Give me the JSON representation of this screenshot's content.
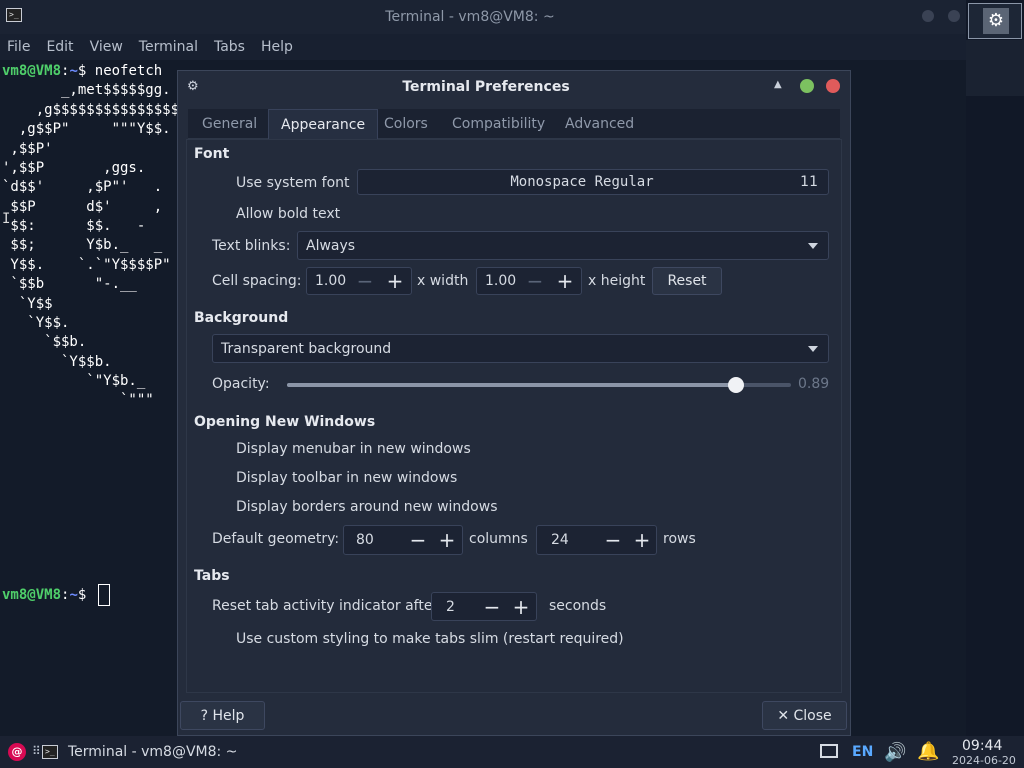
{
  "terminal": {
    "title": "Terminal - vm8@VM8: ~",
    "menu": [
      "File",
      "Edit",
      "View",
      "Terminal",
      "Tabs",
      "Help"
    ],
    "prompt_user": "vm8@VM8",
    "prompt_sep": ":",
    "prompt_path": "~",
    "prompt_suffix": "$",
    "command": "neofetch",
    "ascii_lines": [
      "       _,met$$$$$gg.",
      "    ,g$$$$$$$$$$$$$$$",
      "  ,g$$P\"     \"\"\"Y$$.",
      " ,$$P'",
      "',$$P       ,ggs.",
      "`d$$'     ,$P\"'   .",
      " $$P      d$'     ,",
      " $$:      $$.   -",
      " $$;      Y$b._   _",
      " Y$$.    `.`\"Y$$$$P\"",
      " `$$b      \"-.__",
      "  `Y$$",
      "   `Y$$.",
      "     `$$b.",
      "       `Y$$b.",
      "          `\"Y$b._",
      "              `\"\"\""
    ]
  },
  "workspace_icon": "gear-icon",
  "dialog": {
    "title": "Terminal Preferences",
    "tabs": [
      "General",
      "Appearance",
      "Colors",
      "Compatibility",
      "Advanced"
    ],
    "active_tab": "Appearance",
    "font": {
      "section": "Font",
      "use_system_font": "Use system font",
      "font_name": "Monospace Regular",
      "font_size": "11",
      "allow_bold": "Allow bold text",
      "text_blinks_label": "Text blinks:",
      "text_blinks_value": "Always",
      "cell_spacing_label": "Cell spacing:",
      "width_value": "1.00",
      "width_unit": "x width",
      "height_value": "1.00",
      "height_unit": "x height",
      "reset": "Reset"
    },
    "background": {
      "section": "Background",
      "mode": "Transparent background",
      "opacity_label": "Opacity:",
      "opacity_value": "0.89",
      "opacity_fraction": 0.89
    },
    "new_windows": {
      "section": "Opening New Windows",
      "menubar": "Display menubar in new windows",
      "toolbar": "Display toolbar in new windows",
      "borders": "Display borders around new windows",
      "geometry_label": "Default geometry:",
      "columns_value": "80",
      "columns_unit": "columns",
      "rows_value": "24",
      "rows_unit": "rows"
    },
    "tabs_section": {
      "section": "Tabs",
      "reset_label": "Reset tab activity indicator after",
      "reset_value": "2",
      "reset_unit": "seconds",
      "slim": "Use custom styling to make tabs slim (restart required)"
    },
    "help_button": "? Help",
    "close_button": "✕ Close"
  },
  "taskbar": {
    "task_label": "Terminal - vm8@VM8: ~",
    "keyboard": "EN",
    "time": "09:44",
    "date": "2024-06-20"
  },
  "colors": {
    "accent_prompt_user": "#4fcf6a",
    "accent_prompt_path": "#6e8cff",
    "close": "#e05b5b",
    "maximize": "#7cc160",
    "debian": "#d70a53"
  }
}
